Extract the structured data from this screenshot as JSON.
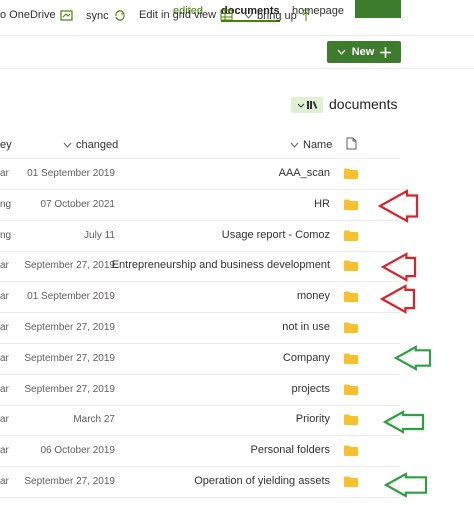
{
  "top_nav": {
    "edited": "edited",
    "documents": "documents",
    "homepage": "homepage",
    "accent_color": "#498205",
    "button_color": "#3c7c2c"
  },
  "commands": {
    "onedrive": "o OneDrive",
    "sync": "sync",
    "grid_view": "Edit in grid view",
    "bring_up": "bring up",
    "new": "New"
  },
  "library": {
    "title": "documents"
  },
  "columns": {
    "key": "ey",
    "changed": "changed",
    "name": "Name"
  },
  "rows": [
    {
      "key": "ar",
      "date": "01 September 2019",
      "name": "AAA_scan"
    },
    {
      "key": "ng",
      "date": "07 October 2021",
      "name": "HR"
    },
    {
      "key": "ng",
      "date": "July 11",
      "name": "Usage report - Comoz"
    },
    {
      "key": "ar",
      "date": "September 27, 2019",
      "name": "Entrepreneurship and business development"
    },
    {
      "key": "ar",
      "date": "01 September 2019",
      "name": "money"
    },
    {
      "key": "ar",
      "date": "September 27, 2019",
      "name": "not in use"
    },
    {
      "key": "ar",
      "date": "September 27, 2019",
      "name": "Company"
    },
    {
      "key": "ar",
      "date": "September 27, 2019",
      "name": "projects"
    },
    {
      "key": "ar",
      "date": "March 27",
      "name": "Priority"
    },
    {
      "key": "ar",
      "date": "06 October 2019",
      "name": "Personal folders"
    },
    {
      "key": "ar",
      "date": "September 27, 2019",
      "name": "Operation of yielding assets"
    }
  ],
  "annotation_colors": {
    "red": "#d9252a",
    "green": "#2ea043"
  },
  "folder_color": "#f8c12c"
}
